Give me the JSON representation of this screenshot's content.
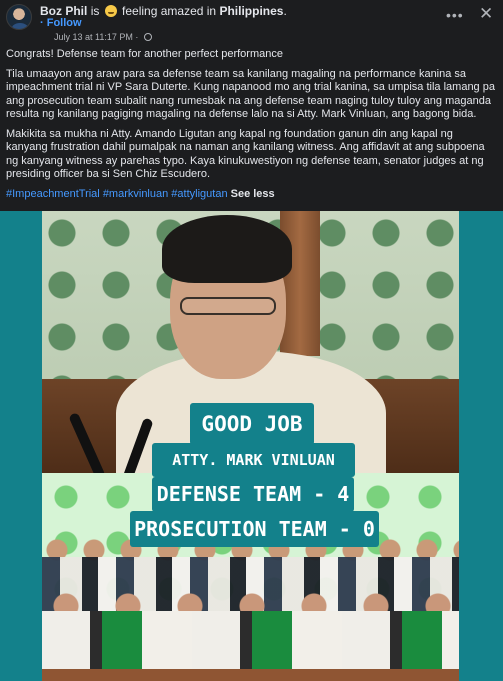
{
  "post": {
    "author": "Boz Phil",
    "status_prefix": "is",
    "feeling": "feeling amazed in",
    "location": "Philippines",
    "follow_label": "Follow",
    "timestamp": "July 13 at 11:17 PM",
    "separator": "·",
    "menu_icon": "more-options-icon",
    "close_icon": "close-icon"
  },
  "caption": {
    "p1": "Congrats! Defense team for another perfect performance",
    "p2": "Tila umaayon ang araw para sa defense team sa kanilang magaling na performance kanina sa impeachment trial ni VP Sara Duterte. Kung napanood mo ang trial kanina, sa umpisa tila lamang pa ang prosecution team subalit nang rumesbak na ang defense team naging tuloy tuloy ang maganda resulta ng kanilang pagiging magaling na defense lalo na si Atty. Mark Vinluan, ang bagong bida.",
    "p3": "Makikita sa mukha ni Atty. Amando Ligutan ang kapal ng foundation ganun din ang kapal ng kanyang frustration dahil pumalpak na naman ang kanilang witness. Ang affidavit at ang subpoena ng kanyang witness ay parehas typo. Kaya kinukuwestiyon ng defense team, senator judges at ng presiding officer ba si Sen Chiz Escudero.",
    "tags": [
      "#ImpeachmentTrial",
      "#markvinluan",
      "#attyligutan"
    ],
    "see_less": "See less"
  },
  "image": {
    "line1": "GOOD JOB",
    "line2": "ATTY. MARK VINLUAN",
    "line3": "DEFENSE TEAM - 4",
    "line4": "PROSECUTION TEAM - 0",
    "bg_color": "#13818b"
  }
}
